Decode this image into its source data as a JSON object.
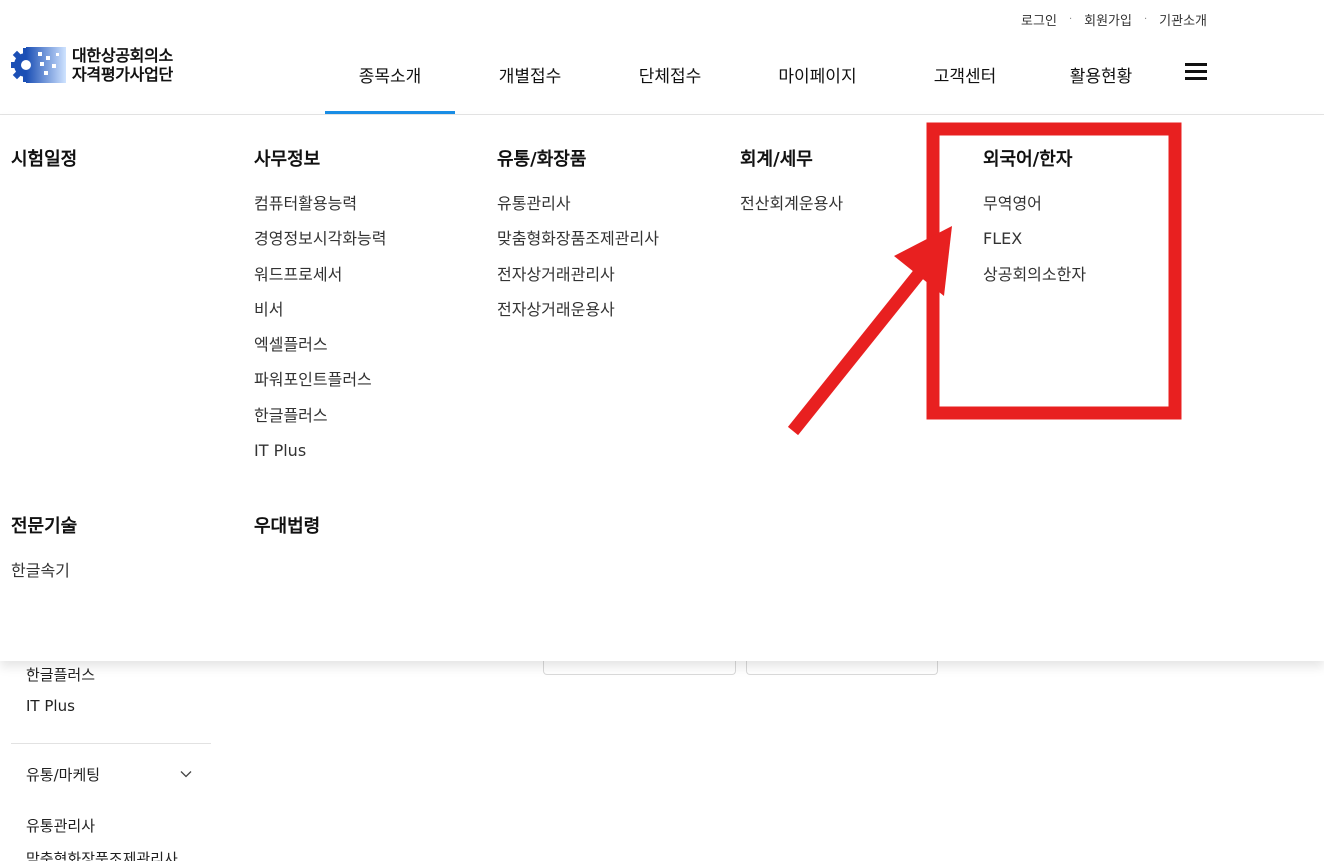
{
  "util_links": [
    "로그인",
    "회원가입",
    "기관소개"
  ],
  "logo": {
    "line1": "대한상공회의소",
    "line2": "자격평가사업단"
  },
  "gnb": [
    "종목소개",
    "개별접수",
    "단체접수",
    "마이페이지",
    "고객센터",
    "활용현황"
  ],
  "mega_menu": {
    "columns": [
      {
        "title": "시험일정",
        "items": []
      },
      {
        "title": "사무정보",
        "items": [
          "컴퓨터활용능력",
          "경영정보시각화능력",
          "워드프로세서",
          "비서",
          "엑셀플러스",
          "파워포인트플러스",
          "한글플러스",
          "IT Plus"
        ]
      },
      {
        "title": "유통/화장품",
        "items": [
          "유통관리사",
          "맞춤형화장품조제관리사",
          "전자상거래관리사",
          "전자상거래운용사"
        ]
      },
      {
        "title": "회계/세무",
        "items": [
          "전산회계운용사"
        ]
      },
      {
        "title": "외국어/한자",
        "items": [
          "무역영어",
          "FLEX",
          "상공회의소한자"
        ]
      },
      {
        "title": "전문기술",
        "items": [
          "한글속기"
        ]
      },
      {
        "title": "우대법령",
        "items": []
      }
    ]
  },
  "background_lnb": {
    "items": [
      "한글플러스",
      "IT Plus"
    ],
    "section_title": "유통/마케팅",
    "section_items": [
      "유통관리사",
      "맞춤형화장품조제관리사"
    ]
  },
  "colors": {
    "accent": "#1a8ee6",
    "annotation": "#e82020",
    "logo_blue": "#1b4fb5"
  }
}
